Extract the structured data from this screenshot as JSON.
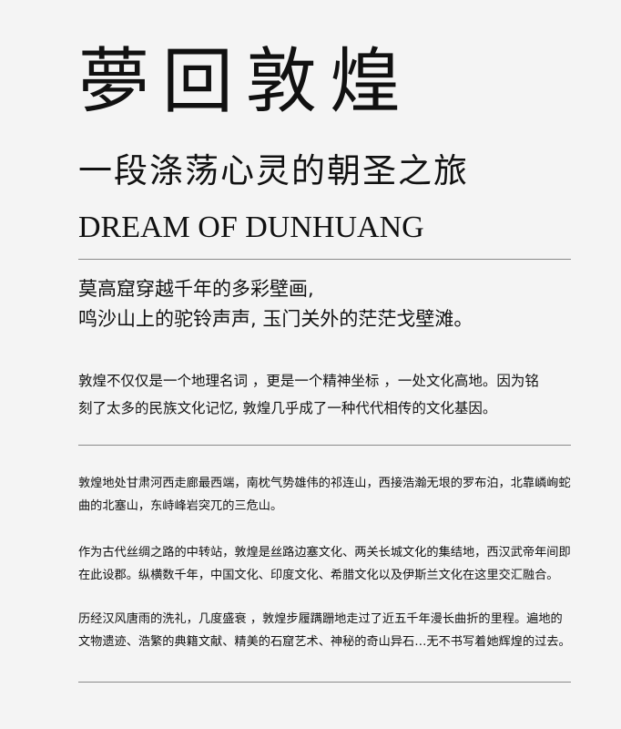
{
  "header": {
    "title_cn": "夢回敦煌",
    "subtitle_cn": "一段涤荡心灵的朝圣之旅",
    "title_en": "DREAM OF DUNHUANG"
  },
  "intro": {
    "lines": [
      "莫高窟穿越千年的多彩壁画,",
      "鸣沙山上的驼铃声声, 玉门关外的茫茫戈壁滩。"
    ]
  },
  "paragraph1": {
    "lines": [
      "敦煌不仅仅是一个地理名词 ，更是一个精神坐标 ，一处文化高地。因为铭",
      "刻了太多的民族文化记忆, 敦煌几乎成了一种代代相传的文化基因。"
    ]
  },
  "details": [
    {
      "lines": [
        "敦煌地处甘肃河西走廊最西端，南枕气势雄伟的祁连山，西接浩瀚无垠的罗布泊，北靠嶙峋蛇",
        "曲的北塞山，东峙峰岩突兀的三危山。"
      ]
    },
    {
      "lines": [
        "作为古代丝绸之路的中转站，敦煌是丝路边塞文化、两关长城文化的集结地，西汉武帝年间即",
        "在此设郡。纵横数千年，中国文化、印度文化、希腊文化以及伊斯兰文化在这里交汇融合。"
      ]
    },
    {
      "lines": [
        "历经汉风唐雨的洗礼，几度盛衰 ，敦煌步履蹒跚地走过了近五千年漫长曲折的里程。遍地的",
        "文物遗迹、浩繁的典籍文献、精美的石窟艺术、神秘的奇山异石…无不书写着她辉煌的过去。"
      ]
    }
  ]
}
